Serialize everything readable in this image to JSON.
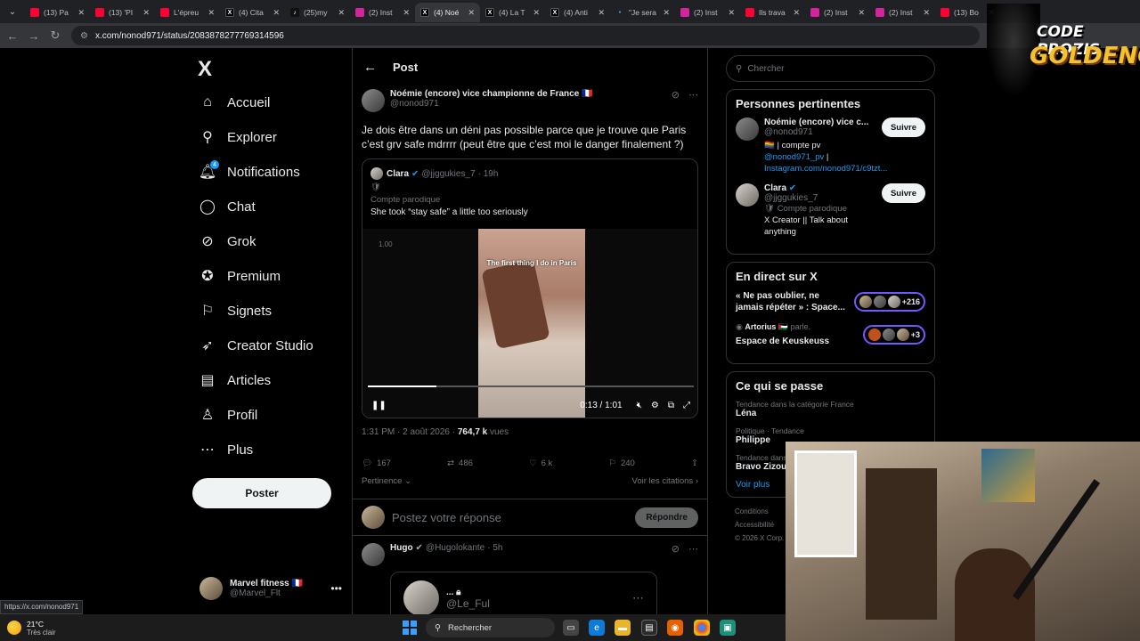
{
  "browser": {
    "tabs": [
      {
        "title": "(13) Pa",
        "icon": "yt"
      },
      {
        "title": "(13) 'PI",
        "icon": "yt"
      },
      {
        "title": "L'épreu",
        "icon": "yt"
      },
      {
        "title": "(4) Cita",
        "icon": "x"
      },
      {
        "title": "(25)my",
        "icon": "tt"
      },
      {
        "title": "(2) Inst",
        "icon": "ig"
      },
      {
        "title": "(4) Noé",
        "icon": "x"
      },
      {
        "title": "(4) La T",
        "icon": "x"
      },
      {
        "title": "(4) Anti",
        "icon": "x"
      },
      {
        "title": "\"Je sera",
        "icon": "dot"
      },
      {
        "title": "(2) Inst",
        "icon": "ig"
      },
      {
        "title": "Ils trava",
        "icon": "yt"
      },
      {
        "title": "(2) Inst",
        "icon": "ig"
      },
      {
        "title": "(2) Inst",
        "icon": "ig"
      },
      {
        "title": "(13) Bo",
        "icon": "yt"
      }
    ],
    "url": "x.com/nonod971/status/2083878277769314596",
    "status_url": "https://x.com/nonod971"
  },
  "nav": {
    "logo": "X",
    "items": [
      {
        "label": "Accueil",
        "icon": "home-icon",
        "glyph": "⌂"
      },
      {
        "label": "Explorer",
        "icon": "search-icon",
        "glyph": "⚲"
      },
      {
        "label": "Notifications",
        "icon": "bell-icon",
        "glyph": "🔔︎"
      },
      {
        "label": "Chat",
        "icon": "chat-icon",
        "glyph": "◯"
      },
      {
        "label": "Grok",
        "icon": "grok-icon",
        "glyph": "⊘"
      },
      {
        "label": "Premium",
        "icon": "premium-icon",
        "glyph": "✪"
      },
      {
        "label": "Signets",
        "icon": "bookmark-icon",
        "glyph": "⚐"
      },
      {
        "label": "Creator Studio",
        "icon": "rocket-icon",
        "glyph": "➶"
      },
      {
        "label": "Articles",
        "icon": "articles-icon",
        "glyph": "▤"
      },
      {
        "label": "Profil",
        "icon": "profile-icon",
        "glyph": "♙"
      },
      {
        "label": "Plus",
        "icon": "more-icon",
        "glyph": "⋯"
      }
    ],
    "notif_badge": "4",
    "post_button": "Poster",
    "account": {
      "name": "Marvel fitness 🇫🇷",
      "handle": "@Marvel_Flt"
    }
  },
  "main": {
    "header_title": "Post",
    "post": {
      "author_name": "Noémie (encore) vice championne de France 🇫🇷",
      "author_handle": "@nonod971",
      "text": "Je dois être dans un déni pas possible parce que je trouve que Paris c’est grv safe mdrrrr (peut être que c’est moi le danger finalement ?)",
      "quote": {
        "name": "Clara",
        "handle": "@jjggukies_7",
        "time": "· 19h",
        "sub": "Compte parodique",
        "text": "She took “stay safe” a little too seriously",
        "video_caption": "The first thing I do in Paris",
        "speed_label": "1.00",
        "time_display": "0:13 / 1:01",
        "progress": 0.21
      },
      "time": "1:31 PM · 2 août 2026 ·",
      "views": "764,7 k",
      "views_label": "vues",
      "replies": "167",
      "reposts": "486",
      "likes": "6 k",
      "bookmarks": "240",
      "sort_label": "Pertinence",
      "quotes_link": "Voir les citations"
    },
    "reply_placeholder": "Postez votre réponse",
    "reply_button": "Répondre",
    "reply2": {
      "name": "Hugo",
      "handle": "@Hugolokante",
      "time": "· 5h",
      "inner_handle": "@Le_Ful",
      "inner_name": "..."
    }
  },
  "right": {
    "search_placeholder": "Chercher",
    "relevant_title": "Personnes pertinentes",
    "people": [
      {
        "name": "Noémie (encore) vice c...",
        "handle": "@nonod971",
        "bio_prefix": "🏳️‍🌈 | compte pv ",
        "bio_link": "@nonod971_pv",
        "bio_sep": " | ",
        "bio_link2": "Instagram.com/nonod971/c9tzt...",
        "follow": "Suivre"
      },
      {
        "name": "Clara",
        "handle": "@jjggukies_7",
        "bio_prefix": "🛡 Compte parodique",
        "bio2": "X Creator || Talk about anything",
        "follow": "Suivre"
      }
    ],
    "live_title": "En direct sur X",
    "live": [
      {
        "title": "« Ne pas oublier, ne jamais répéter » : Space...",
        "count": "+216"
      },
      {
        "host": "Artorius 🇵🇸",
        "host_suffix": "parle.",
        "title": "Espace de Keuskeuss",
        "count": "+3"
      }
    ],
    "trends_title": "Ce qui se passe",
    "trends": [
      {
        "ctx": "Tendance dans la catégorie France",
        "name": "Léna"
      },
      {
        "ctx": "Politique · Tendance",
        "name": "Philippe"
      },
      {
        "ctx": "Tendance dans la catégorie France",
        "name": "Bravo Zizou"
      }
    ],
    "show_more": "Voir plus",
    "footer": [
      "Conditions",
      "Accessibilité",
      "© 2026 X Corp."
    ]
  },
  "overlay": {
    "logo_line1": "CODE PROZIS",
    "logo_line2": "GOLDENG"
  },
  "taskbar": {
    "temp": "21°C",
    "weather": "Très clair",
    "search": "Rechercher"
  }
}
